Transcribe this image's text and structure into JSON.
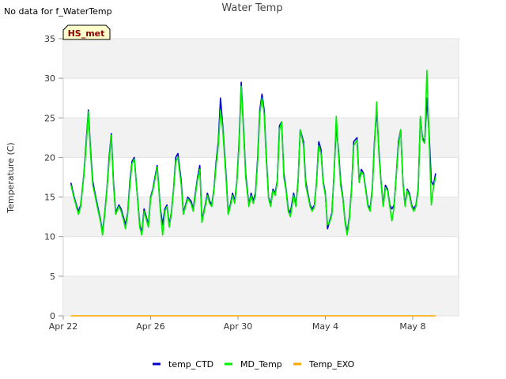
{
  "notice": "No data for f_WaterTemp",
  "chart_data": {
    "type": "line",
    "title": "Water Temp",
    "xlabel": "",
    "ylabel": "Temperature (C)",
    "ylim": [
      0,
      35
    ],
    "yticks": [
      0,
      5,
      10,
      15,
      20,
      25,
      30,
      35
    ],
    "xlim": [
      0,
      18.1
    ],
    "xticks": [
      {
        "x": 0,
        "label": "Apr 22"
      },
      {
        "x": 4,
        "label": "Apr 26"
      },
      {
        "x": 8,
        "label": "Apr 30"
      },
      {
        "x": 12,
        "label": "May 4"
      },
      {
        "x": 16,
        "label": "May 8"
      }
    ],
    "grid": true,
    "legend_position": "bottom",
    "station_badge": "HS_met",
    "series": [
      {
        "name": "temp_CTD",
        "color": "#0000cc"
      },
      {
        "name": "MD_Temp",
        "color": "#00ee00"
      },
      {
        "name": "Temp_EXO",
        "color": "#ffa500"
      }
    ],
    "x": [
      0.35,
      0.5,
      0.6,
      0.7,
      0.8,
      0.95,
      1.05,
      1.15,
      1.25,
      1.35,
      1.45,
      1.6,
      1.7,
      1.8,
      1.9,
      2.0,
      2.1,
      2.2,
      2.3,
      2.4,
      2.55,
      2.65,
      2.75,
      2.85,
      2.95,
      3.05,
      3.15,
      3.25,
      3.4,
      3.5,
      3.6,
      3.7,
      3.8,
      3.9,
      4.0,
      4.1,
      4.2,
      4.3,
      4.45,
      4.55,
      4.65,
      4.75,
      4.85,
      4.95,
      5.05,
      5.15,
      5.25,
      5.4,
      5.5,
      5.6,
      5.7,
      5.85,
      5.95,
      6.05,
      6.15,
      6.25,
      6.35,
      6.5,
      6.6,
      6.7,
      6.8,
      6.9,
      7.0,
      7.1,
      7.2,
      7.3,
      7.45,
      7.55,
      7.65,
      7.75,
      7.85,
      7.95,
      8.05,
      8.15,
      8.25,
      8.35,
      8.5,
      8.6,
      8.7,
      8.8,
      8.9,
      9.0,
      9.1,
      9.2,
      9.3,
      9.4,
      9.5,
      9.6,
      9.7,
      9.8,
      9.9,
      10.0,
      10.1,
      10.2,
      10.3,
      10.4,
      10.55,
      10.65,
      10.75,
      10.85,
      11.0,
      11.1,
      11.2,
      11.3,
      11.4,
      11.5,
      11.6,
      11.7,
      11.8,
      11.9,
      12.0,
      12.1,
      12.2,
      12.3,
      12.4,
      12.5,
      12.6,
      12.7,
      12.8,
      12.9,
      13.0,
      13.1,
      13.2,
      13.3,
      13.45,
      13.55,
      13.65,
      13.75,
      13.85,
      13.95,
      14.05,
      14.15,
      14.25,
      14.35,
      14.45,
      14.55,
      14.65,
      14.75,
      14.85,
      14.95,
      15.05,
      15.15,
      15.25,
      15.35,
      15.45,
      15.55,
      15.65,
      15.75,
      15.85,
      15.95,
      16.05,
      16.15,
      16.25,
      16.35,
      16.45,
      16.55,
      16.65,
      16.75,
      16.85,
      16.95,
      17.05
    ],
    "temp_CTD": [
      16.8,
      15,
      14,
      13.2,
      14,
      18,
      22,
      26,
      21,
      17,
      15.5,
      13.5,
      12.2,
      10.5,
      13,
      16,
      20,
      23,
      17,
      13,
      14,
      13.5,
      12.5,
      11.5,
      13,
      17,
      19.5,
      20,
      15,
      11.5,
      10.5,
      13.5,
      12.5,
      11.5,
      15,
      16,
      17.5,
      19,
      13.5,
      11.5,
      13.5,
      14,
      11.5,
      13,
      16,
      20,
      20.5,
      17,
      13,
      14,
      15,
      14.5,
      13.5,
      15.5,
      17.5,
      19,
      12,
      14,
      15.5,
      14.5,
      14,
      16,
      19.5,
      22,
      27.5,
      24,
      18,
      13,
      14,
      15.5,
      14.5,
      17,
      22,
      29.5,
      24,
      18,
      14,
      15.5,
      14.5,
      15.5,
      20,
      26,
      28,
      26,
      20,
      15,
      14,
      16,
      15.5,
      17,
      24,
      24.5,
      18,
      16,
      13.5,
      13,
      15.5,
      14,
      17,
      23.5,
      22,
      17,
      15.5,
      14,
      13.5,
      14,
      17,
      22,
      21,
      17,
      15.5,
      11,
      12,
      13,
      18,
      24,
      21,
      17,
      15,
      12,
      10.5,
      12.5,
      16,
      22,
      22.5,
      17,
      18.5,
      18,
      16,
      14,
      13.5,
      16,
      22,
      26,
      21,
      17,
      14,
      16.5,
      16,
      14,
      13.5,
      14,
      18,
      22,
      23.5,
      17,
      14,
      16,
      15.5,
      14,
      13.5,
      14,
      16,
      25,
      22.5,
      22,
      27.5,
      23,
      17,
      16.5,
      18
    ],
    "MD_Temp": [
      16.5,
      14.8,
      13.8,
      12.8,
      13.8,
      17.8,
      21.5,
      25.8,
      20.5,
      16.5,
      15.2,
      13.2,
      12,
      10.2,
      12.8,
      15.8,
      19.5,
      22.8,
      16.5,
      12.8,
      13.8,
      13.2,
      12.2,
      11,
      12.8,
      16.5,
      19.2,
      19.8,
      14.8,
      11.2,
      10.2,
      13.2,
      12.2,
      11.2,
      14.8,
      15.8,
      17.2,
      18.8,
      13.2,
      10.2,
      13.2,
      13.8,
      11.2,
      12.8,
      15.8,
      19.5,
      20,
      16.5,
      12.8,
      13.8,
      14.8,
      14.2,
      13.2,
      15.2,
      17.2,
      18.5,
      11.8,
      13.8,
      15.2,
      14.2,
      13.8,
      15.8,
      19,
      21.5,
      26,
      23.5,
      17.5,
      12.8,
      13.8,
      15.2,
      14.2,
      16.8,
      21.5,
      29,
      23.5,
      17.5,
      13.8,
      15.2,
      14.2,
      15.2,
      19.5,
      25.5,
      27.5,
      25.5,
      19.5,
      14.8,
      13.8,
      15.8,
      15.2,
      16.8,
      23.5,
      24.5,
      17.5,
      15.8,
      13.2,
      12.5,
      15.2,
      13.8,
      16.8,
      23.5,
      21.5,
      16.5,
      15.2,
      13.8,
      13.2,
      13.8,
      16.8,
      21.5,
      20.5,
      16.8,
      15.2,
      11.5,
      11.8,
      12.8,
      17.8,
      25.2,
      20.5,
      16.5,
      14.8,
      11.8,
      10.2,
      12.2,
      15.8,
      21.5,
      22.2,
      16.8,
      18.2,
      17.8,
      15.8,
      13.8,
      13.2,
      15.8,
      21.5,
      27,
      20.5,
      16.8,
      13.8,
      16.2,
      15.8,
      13.8,
      12,
      13.8,
      17.8,
      21.5,
      23.5,
      16.8,
      13.8,
      15.8,
      15.2,
      13.8,
      13.2,
      13.8,
      15.8,
      25.2,
      22.2,
      21.8,
      31,
      22.5,
      14,
      16.2,
      17.5
    ],
    "Temp_EXO_x": [
      0.35,
      17.05
    ],
    "Temp_EXO": [
      0,
      0
    ]
  }
}
